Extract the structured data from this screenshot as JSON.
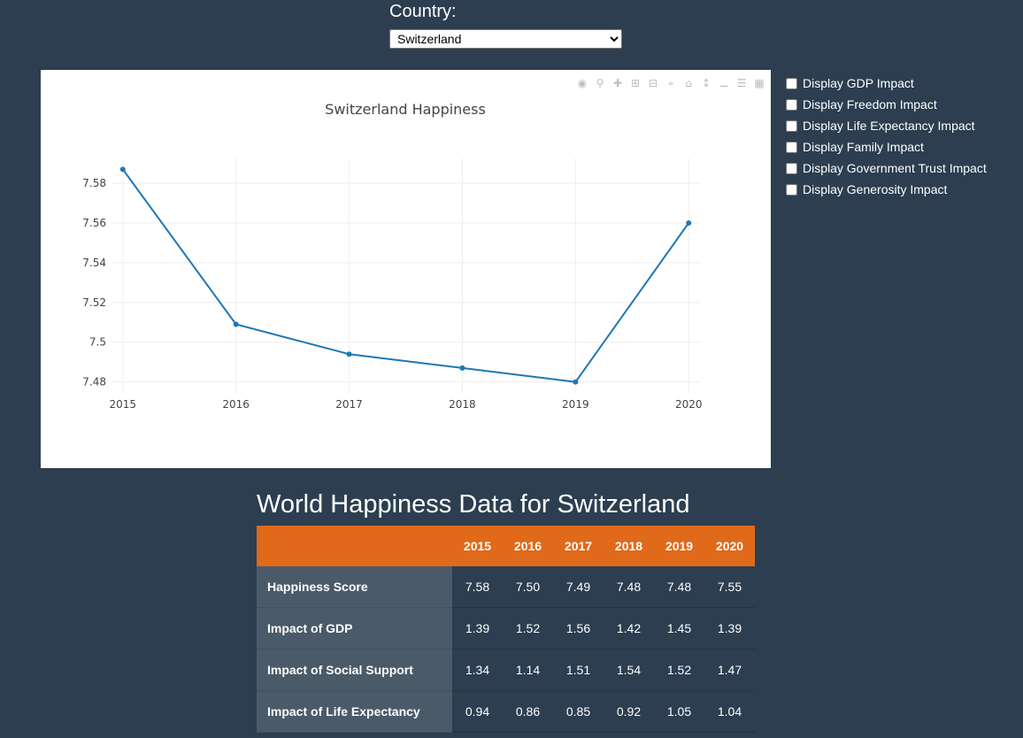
{
  "country": {
    "label": "Country:",
    "selected": "Switzerland"
  },
  "checkboxes": [
    {
      "label": "Display GDP Impact",
      "checked": false
    },
    {
      "label": "Display Freedom Impact",
      "checked": false
    },
    {
      "label": "Display Life Expectancy Impact",
      "checked": false
    },
    {
      "label": "Display Family Impact",
      "checked": false
    },
    {
      "label": "Display Government Trust Impact",
      "checked": false
    },
    {
      "label": "Display Generosity Impact",
      "checked": false
    }
  ],
  "chart_data": {
    "type": "line",
    "title": "Switzerland Happiness",
    "x": [
      2015,
      2016,
      2017,
      2018,
      2019,
      2020
    ],
    "series": [
      {
        "values": [
          7.587,
          7.509,
          7.494,
          7.487,
          7.48,
          7.56
        ],
        "color": "#1f77b4"
      }
    ],
    "y_ticks": [
      "7.48",
      "7.5",
      "7.52",
      "7.54",
      "7.56",
      "7.58"
    ],
    "x_ticks": [
      "2015",
      "2016",
      "2017",
      "2018",
      "2019",
      "2020"
    ],
    "ylim": [
      7.4745,
      7.5925
    ],
    "grid": true
  },
  "table": {
    "title": "World Happiness Data for Switzerland",
    "columns": [
      "2015",
      "2016",
      "2017",
      "2018",
      "2019",
      "2020"
    ],
    "rows": [
      {
        "label": "Happiness Score",
        "values": [
          "7.58",
          "7.50",
          "7.49",
          "7.48",
          "7.48",
          "7.55"
        ]
      },
      {
        "label": "Impact of GDP",
        "values": [
          "1.39",
          "1.52",
          "1.56",
          "1.42",
          "1.45",
          "1.39"
        ]
      },
      {
        "label": "Impact of Social Support",
        "values": [
          "1.34",
          "1.14",
          "1.51",
          "1.54",
          "1.52",
          "1.47"
        ]
      },
      {
        "label": "Impact of Life Expectancy",
        "values": [
          "0.94",
          "0.86",
          "0.85",
          "0.92",
          "1.05",
          "1.04"
        ]
      }
    ]
  }
}
